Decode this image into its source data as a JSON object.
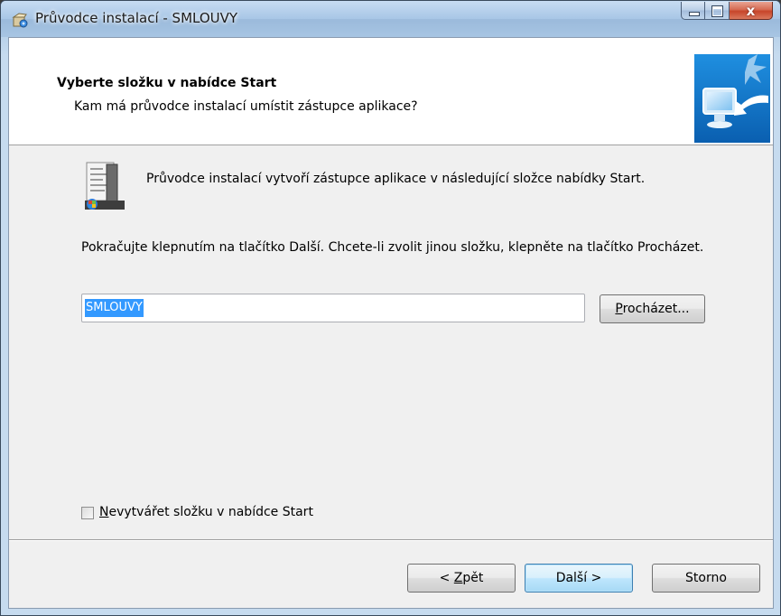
{
  "window": {
    "title": "Průvodce instalací - SMLOUVY",
    "icon": "setup-box-icon",
    "controls": {
      "minimize": "minimize-icon",
      "maximize": "maximize-icon",
      "close": "x"
    }
  },
  "header": {
    "title": "Vyberte složku v nabídce Start",
    "subtitle": "Kam má průvodce instalací umístit zástupce aplikace?",
    "image": "monitor-arrow-icon"
  },
  "body": {
    "icon": "start-menu-folder-icon",
    "description1": "Průvodce instalací vytvoří zástupce aplikace v následující složce nabídky Start.",
    "description2": "Pokračujte klepnutím na tlačítko Další. Chcete-li zvolit jinou složku, klepněte na tlačítko Procházet.",
    "folder_value": "SMLOUVY",
    "browse_button": {
      "pre": "",
      "accel": "P",
      "post": "rocházet..."
    },
    "no_folder_checkbox": {
      "accel": "N",
      "post": "evytvářet složku v nabídce Start",
      "checked": false
    }
  },
  "footer": {
    "back_button": {
      "pre": "< ",
      "accel": "Z",
      "post": "pět"
    },
    "next_button": "Další >",
    "cancel_button": "Storno"
  },
  "colors": {
    "accent": "#3399ff",
    "close_red": "#c7452a",
    "dialog_bg": "#f0f0f0"
  }
}
